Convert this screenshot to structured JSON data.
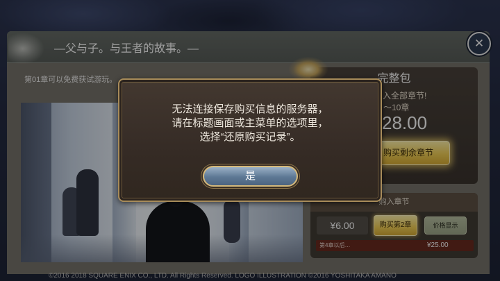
{
  "screen": {
    "title": "—父与子。与王者的故事。—"
  },
  "close_button": {
    "icon": "close-icon",
    "glyph": "✕"
  },
  "chapter_info": {
    "free_note": "第01章可以免费获试游玩。"
  },
  "full_pack": {
    "title": "完整包",
    "description": "入全部章节!",
    "chapters": "～10章",
    "price": "28.00",
    "buy_label": "购买剩余章节"
  },
  "chapter_purchase": {
    "title": "购入章节",
    "price": "¥6.00",
    "buy_label": "购买第2章",
    "price_label": "价格显示",
    "later_note": "第4章以后…",
    "later_price": "¥25.00"
  },
  "footer": {
    "copyright": "©2016 2018 SQUARE ENIX CO., LTD. All Rights Reserved. LOGO ILLUSTRATION ©2016 YOSHITAKA AMANO"
  },
  "dialog": {
    "lines": [
      "无法连接保存购买信息的服务器，",
      "请在标题画面或主菜单的选项里，",
      "选择“还原购买记录”。"
    ],
    "confirm_label": "是"
  },
  "colors": {
    "dialog_border_gold": "#a88c5a",
    "confirm_button_blue": "#5d7894",
    "buy_button_yellow": "#f2cf55",
    "price_button_green": "#9fa88a",
    "later_bar_red": "#6a2a20"
  }
}
